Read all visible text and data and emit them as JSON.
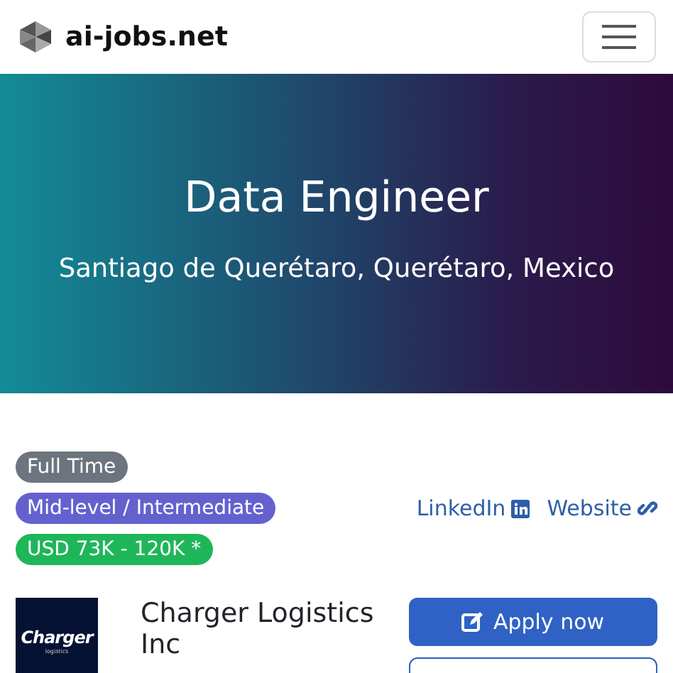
{
  "navbar": {
    "brand": "ai-jobs.net"
  },
  "hero": {
    "title": "Data Engineer",
    "location": "Santiago de Querétaro, Querétaro, Mexico"
  },
  "badges": [
    {
      "label": "Full Time",
      "color": "#6c757d"
    },
    {
      "label": "Mid-level / Intermediate",
      "color": "#6461cf"
    },
    {
      "label": "USD 73K - 120K *",
      "color": "#1fb65a"
    }
  ],
  "links": [
    {
      "label": "LinkedIn",
      "kind": "linkedin"
    },
    {
      "label": "Website",
      "kind": "link"
    }
  ],
  "company": {
    "name": "Charger Logistics Inc",
    "logo_text": "Charger",
    "logo_subtext": "logistics"
  },
  "actions": [
    {
      "label": "Apply now",
      "kind": "primary"
    },
    {
      "kind": "outline"
    }
  ]
}
